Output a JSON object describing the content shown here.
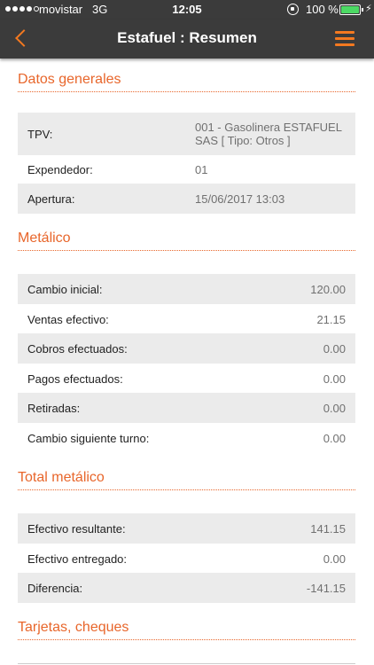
{
  "status_bar": {
    "carrier": "movistar",
    "network": "3G",
    "time": "12:05",
    "battery_percent": "100 %",
    "battery_color": "#4cd964",
    "charging_icon": "⚡"
  },
  "nav": {
    "title": "Estafuel : Resumen",
    "accent_color": "#f47920",
    "background_color": "#3b3b3b"
  },
  "sections": {
    "datos_generales": {
      "title": "Datos generales",
      "rows": [
        {
          "label": "TPV:",
          "value": "001 - Gasolinera ESTAFUEL SAS [ Tipo: Otros ]"
        },
        {
          "label": "Expendedor:",
          "value": "01"
        },
        {
          "label": "Apertura:",
          "value": "15/06/2017 13:03"
        }
      ]
    },
    "metalico": {
      "title": "Metálico",
      "rows": [
        {
          "label": "Cambio inicial:",
          "value": "120.00"
        },
        {
          "label": "Ventas efectivo:",
          "value": "21.15"
        },
        {
          "label": "Cobros efectuados:",
          "value": "0.00"
        },
        {
          "label": "Pagos efectuados:",
          "value": "0.00"
        },
        {
          "label": "Retiradas:",
          "value": "0.00"
        },
        {
          "label": "Cambio siguiente turno:",
          "value": "0.00"
        }
      ]
    },
    "total_metalico": {
      "title": "Total metálico",
      "rows": [
        {
          "label": "Efectivo resultante:",
          "value": "141.15"
        },
        {
          "label": "Efectivo entregado:",
          "value": "0.00"
        },
        {
          "label": "Diferencia:",
          "value": "-141.15"
        }
      ]
    },
    "tarjetas": {
      "title": "Tarjetas, cheques"
    }
  }
}
